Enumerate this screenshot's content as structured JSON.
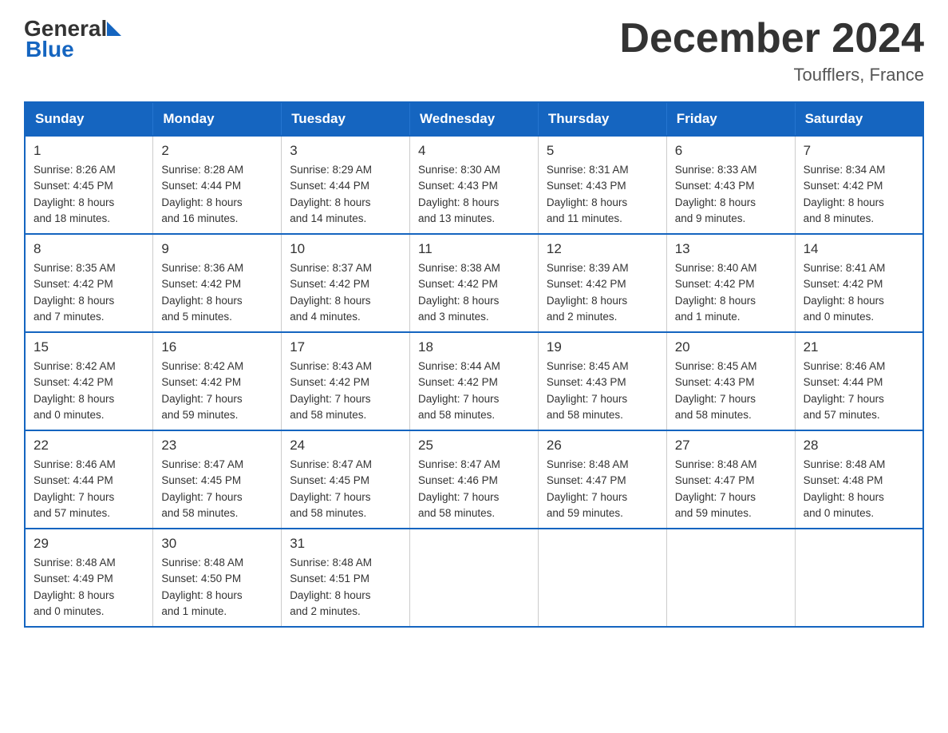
{
  "header": {
    "logo": {
      "general": "General",
      "blue": "Blue"
    },
    "title": "December 2024",
    "location": "Toufflers, France"
  },
  "days_of_week": [
    "Sunday",
    "Monday",
    "Tuesday",
    "Wednesday",
    "Thursday",
    "Friday",
    "Saturday"
  ],
  "weeks": [
    [
      {
        "day": "1",
        "sunrise": "8:26 AM",
        "sunset": "4:45 PM",
        "daylight": "8 hours",
        "daylight2": "and 18 minutes."
      },
      {
        "day": "2",
        "sunrise": "8:28 AM",
        "sunset": "4:44 PM",
        "daylight": "8 hours",
        "daylight2": "and 16 minutes."
      },
      {
        "day": "3",
        "sunrise": "8:29 AM",
        "sunset": "4:44 PM",
        "daylight": "8 hours",
        "daylight2": "and 14 minutes."
      },
      {
        "day": "4",
        "sunrise": "8:30 AM",
        "sunset": "4:43 PM",
        "daylight": "8 hours",
        "daylight2": "and 13 minutes."
      },
      {
        "day": "5",
        "sunrise": "8:31 AM",
        "sunset": "4:43 PM",
        "daylight": "8 hours",
        "daylight2": "and 11 minutes."
      },
      {
        "day": "6",
        "sunrise": "8:33 AM",
        "sunset": "4:43 PM",
        "daylight": "8 hours",
        "daylight2": "and 9 minutes."
      },
      {
        "day": "7",
        "sunrise": "8:34 AM",
        "sunset": "4:42 PM",
        "daylight": "8 hours",
        "daylight2": "and 8 minutes."
      }
    ],
    [
      {
        "day": "8",
        "sunrise": "8:35 AM",
        "sunset": "4:42 PM",
        "daylight": "8 hours",
        "daylight2": "and 7 minutes."
      },
      {
        "day": "9",
        "sunrise": "8:36 AM",
        "sunset": "4:42 PM",
        "daylight": "8 hours",
        "daylight2": "and 5 minutes."
      },
      {
        "day": "10",
        "sunrise": "8:37 AM",
        "sunset": "4:42 PM",
        "daylight": "8 hours",
        "daylight2": "and 4 minutes."
      },
      {
        "day": "11",
        "sunrise": "8:38 AM",
        "sunset": "4:42 PM",
        "daylight": "8 hours",
        "daylight2": "and 3 minutes."
      },
      {
        "day": "12",
        "sunrise": "8:39 AM",
        "sunset": "4:42 PM",
        "daylight": "8 hours",
        "daylight2": "and 2 minutes."
      },
      {
        "day": "13",
        "sunrise": "8:40 AM",
        "sunset": "4:42 PM",
        "daylight": "8 hours",
        "daylight2": "and 1 minute."
      },
      {
        "day": "14",
        "sunrise": "8:41 AM",
        "sunset": "4:42 PM",
        "daylight": "8 hours",
        "daylight2": "and 0 minutes."
      }
    ],
    [
      {
        "day": "15",
        "sunrise": "8:42 AM",
        "sunset": "4:42 PM",
        "daylight": "8 hours",
        "daylight2": "and 0 minutes."
      },
      {
        "day": "16",
        "sunrise": "8:42 AM",
        "sunset": "4:42 PM",
        "daylight": "7 hours",
        "daylight2": "and 59 minutes."
      },
      {
        "day": "17",
        "sunrise": "8:43 AM",
        "sunset": "4:42 PM",
        "daylight": "7 hours",
        "daylight2": "and 58 minutes."
      },
      {
        "day": "18",
        "sunrise": "8:44 AM",
        "sunset": "4:42 PM",
        "daylight": "7 hours",
        "daylight2": "and 58 minutes."
      },
      {
        "day": "19",
        "sunrise": "8:45 AM",
        "sunset": "4:43 PM",
        "daylight": "7 hours",
        "daylight2": "and 58 minutes."
      },
      {
        "day": "20",
        "sunrise": "8:45 AM",
        "sunset": "4:43 PM",
        "daylight": "7 hours",
        "daylight2": "and 58 minutes."
      },
      {
        "day": "21",
        "sunrise": "8:46 AM",
        "sunset": "4:44 PM",
        "daylight": "7 hours",
        "daylight2": "and 57 minutes."
      }
    ],
    [
      {
        "day": "22",
        "sunrise": "8:46 AM",
        "sunset": "4:44 PM",
        "daylight": "7 hours",
        "daylight2": "and 57 minutes."
      },
      {
        "day": "23",
        "sunrise": "8:47 AM",
        "sunset": "4:45 PM",
        "daylight": "7 hours",
        "daylight2": "and 58 minutes."
      },
      {
        "day": "24",
        "sunrise": "8:47 AM",
        "sunset": "4:45 PM",
        "daylight": "7 hours",
        "daylight2": "and 58 minutes."
      },
      {
        "day": "25",
        "sunrise": "8:47 AM",
        "sunset": "4:46 PM",
        "daylight": "7 hours",
        "daylight2": "and 58 minutes."
      },
      {
        "day": "26",
        "sunrise": "8:48 AM",
        "sunset": "4:47 PM",
        "daylight": "7 hours",
        "daylight2": "and 59 minutes."
      },
      {
        "day": "27",
        "sunrise": "8:48 AM",
        "sunset": "4:47 PM",
        "daylight": "7 hours",
        "daylight2": "and 59 minutes."
      },
      {
        "day": "28",
        "sunrise": "8:48 AM",
        "sunset": "4:48 PM",
        "daylight": "8 hours",
        "daylight2": "and 0 minutes."
      }
    ],
    [
      {
        "day": "29",
        "sunrise": "8:48 AM",
        "sunset": "4:49 PM",
        "daylight": "8 hours",
        "daylight2": "and 0 minutes."
      },
      {
        "day": "30",
        "sunrise": "8:48 AM",
        "sunset": "4:50 PM",
        "daylight": "8 hours",
        "daylight2": "and 1 minute."
      },
      {
        "day": "31",
        "sunrise": "8:48 AM",
        "sunset": "4:51 PM",
        "daylight": "8 hours",
        "daylight2": "and 2 minutes."
      },
      null,
      null,
      null,
      null
    ]
  ],
  "labels": {
    "sunrise": "Sunrise:",
    "sunset": "Sunset:",
    "daylight": "Daylight:"
  }
}
